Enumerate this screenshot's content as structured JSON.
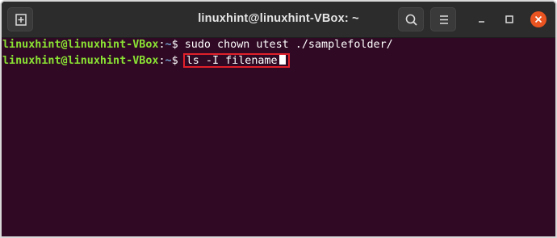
{
  "window": {
    "title": "linuxhint@linuxhint-VBox: ~"
  },
  "titlebar": {
    "left_icon": "new-tab-icon",
    "search_icon": "search-icon",
    "menu_icon": "hamburger-menu-icon",
    "minimize_icon": "minimize-icon",
    "maximize_icon": "maximize-icon",
    "close_icon": "close-icon"
  },
  "colors": {
    "terminal_bg": "#300a24",
    "prompt_user": "#8ae234",
    "prompt_path": "#729fcf",
    "close_button": "#e95420",
    "highlight_border": "#e0202a"
  },
  "terminal": {
    "lines": [
      {
        "user": "linuxhint@linuxhint-VBox",
        "colon": ":",
        "path": "~",
        "dollar": "$ ",
        "command": "sudo chown utest ./samplefolder/"
      },
      {
        "user": "linuxhint@linuxhint-VBox",
        "colon": ":",
        "path": "~",
        "dollar": "$ ",
        "command": "ls -I filename"
      }
    ]
  }
}
